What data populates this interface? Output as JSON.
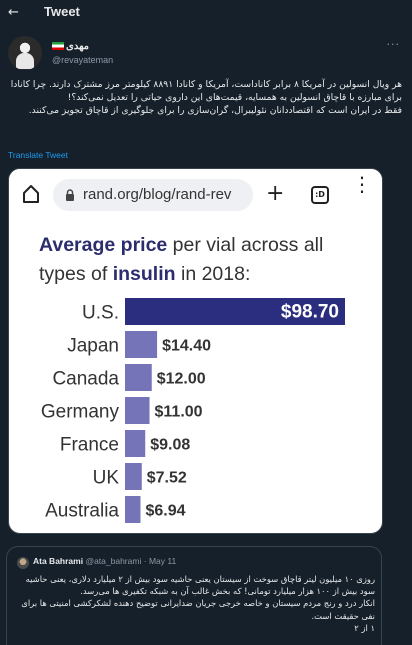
{
  "topbar": {
    "back_icon": "arrow-left-icon",
    "back_glyph": "←",
    "title": "Tweet"
  },
  "author": {
    "display_name": "مهدی",
    "handle": "@revayateman",
    "more_glyph": "···",
    "flag_colors": [
      "#239f40",
      "#ffffff",
      "#da0000"
    ]
  },
  "tweet": {
    "text": "هر ویال انسولین در آمریکا ۸ برابر کاناداست، آمریکا و کانادا ۸۸۹۱ کیلومتر مرز مشترک دارند. چرا کانادا برای مبارزه با قاچاق انسولین به همسایه، قیمت‌های این داروی حیاتی را تعدیل نمی‌کند؟!\nفقط در ایران است که اقتصاددانان نئولیبرال، گران‌سازی را برای جلوگیری از قاچاق تجویز می‌کنند.",
    "translate_label": "Translate Tweet"
  },
  "media": {
    "browser": {
      "url": "rand.org/blog/rand-rev",
      "tabs_count": ":D",
      "home_icon": "home-icon",
      "lock_icon": "lock-icon",
      "plus_glyph": "+",
      "menu_glyph": "⋮"
    },
    "chart_title_part1": "Average price",
    "chart_title_part2": " per vial across all types of ",
    "chart_title_part3": "insulin",
    "chart_title_part4": " in 2018:"
  },
  "chart_data": {
    "type": "bar",
    "orientation": "horizontal",
    "title": "Average price per vial across all types of insulin in 2018:",
    "categories": [
      "U.S.",
      "Japan",
      "Canada",
      "Germany",
      "France",
      "UK",
      "Australia"
    ],
    "values": [
      98.7,
      14.4,
      12.0,
      11.0,
      9.08,
      7.52,
      6.94
    ],
    "value_labels": [
      "$98.70",
      "$14.40",
      "$12.00",
      "$11.00",
      "$9.08",
      "$7.52",
      "$6.94"
    ],
    "colors": {
      "highlight": "#2b2d7e",
      "bar": "#7574b8",
      "label_dark": "#333333",
      "label_on_bar": "#ffffff"
    },
    "xlim": [
      0,
      98.7
    ],
    "grid": false,
    "legend": "none"
  },
  "quote": {
    "name": "Ata Bahrami",
    "handle": "@ata_bahrami",
    "date": "May 11",
    "text": "روزی ۱۰ میلیون لیتر قاچاق سوخت از سیستان یعنی حاشیه سود بیش از ۲ میلیارد دلاری، یعنی حاشیه سود بیش از ۱۰۰ هزار میلیارد تومانی! که بخش غالب آن به شبکه تکفیری ها می‌رسد.\nانکار درد و رنج مردم سیستان و خاصه خرجی جریان ضدایرانی توضیح دهنده لشکرکشی امنیتی ها برای نفی حقیقت است.\n۱ از ۲"
  }
}
